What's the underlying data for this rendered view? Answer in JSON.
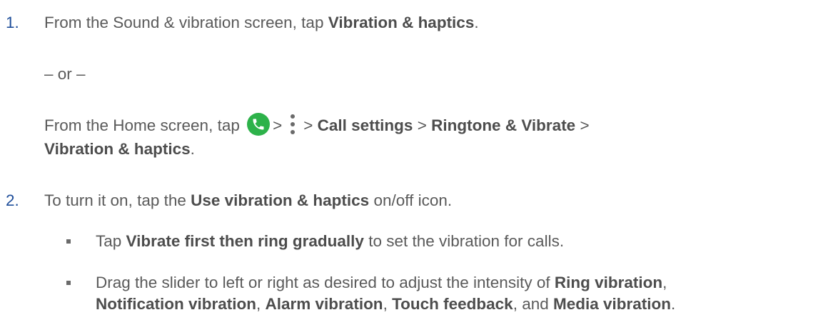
{
  "steps": [
    {
      "num": "1.",
      "line1": {
        "t1": "From the Sound & vibration screen, tap ",
        "b1": "Vibration & haptics",
        "t2": "."
      },
      "or_text": "– or –",
      "alt_line1": {
        "t1": "From the Home screen, tap ",
        "sep1": ">",
        "sep2": "> ",
        "b1": "Call settings",
        "sep3": " > ",
        "b2": "Ringtone & Vibrate",
        "sep4": " >"
      },
      "alt_line2": {
        "b1": "Vibration & haptics",
        "t1": "."
      }
    },
    {
      "num": "2.",
      "line1": {
        "t1": "To turn it on, tap the ",
        "b1": "Use vibration & haptics",
        "t2": " on/off icon."
      },
      "bullets": [
        {
          "t1": "Tap ",
          "b1": "Vibrate first then ring gradually",
          "t2": " to set the vibration for calls."
        },
        {
          "line1": {
            "t1": "Drag the slider to left or right as desired to adjust the intensity of ",
            "b1": "Ring vibration",
            "t2": ","
          },
          "line2": {
            "b1": "Notification vibration",
            "t1": ", ",
            "b2": "Alarm vibration",
            "t2": ", ",
            "b3": "Touch feedback",
            "t3": ", and ",
            "b4": "Media vibration",
            "t4": "."
          }
        }
      ]
    }
  ],
  "icons": {
    "phone": "phone-app-icon",
    "more": "more-options-icon"
  },
  "colors": {
    "step_number": "#1f4e9a",
    "body_text": "#5a5a5a",
    "phone_icon_bg": "#2db24a"
  }
}
